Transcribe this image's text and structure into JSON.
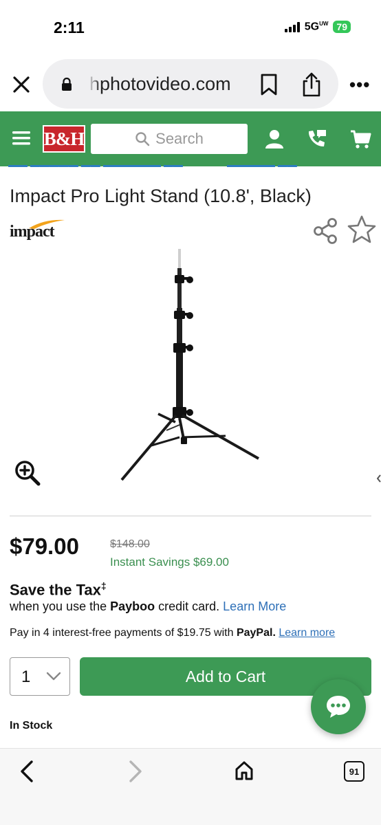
{
  "status": {
    "time": "2:11",
    "network": "5G",
    "network_sup": "UW",
    "battery": "79"
  },
  "browser": {
    "url": "hphotovideo.com"
  },
  "header": {
    "logo": "B&H",
    "search_placeholder": "Search"
  },
  "product": {
    "title": "Impact Pro Light Stand (10.8', Black)",
    "brand": "impact",
    "price": "$79.00",
    "list_price": "$148.00",
    "savings": "Instant Savings $69.00",
    "tax_title": "Save the Tax",
    "tax_mark": "‡",
    "tax_prefix": "when you use the ",
    "tax_card": "Payboo",
    "tax_suffix": " credit card. ",
    "tax_link": "Learn More",
    "paypal_prefix": "Pay in 4 interest-free payments of $19.75 with ",
    "paypal_brand": "PayPal.",
    "paypal_link": "Learn more",
    "quantity": "1",
    "add_to_cart": "Add to Cart",
    "stock": "In Stock"
  },
  "bottom": {
    "tab_count": "91"
  },
  "colors": {
    "brand_green": "#3d9a55",
    "logo_red": "#c8262c",
    "link_blue": "#2d6fb7"
  }
}
